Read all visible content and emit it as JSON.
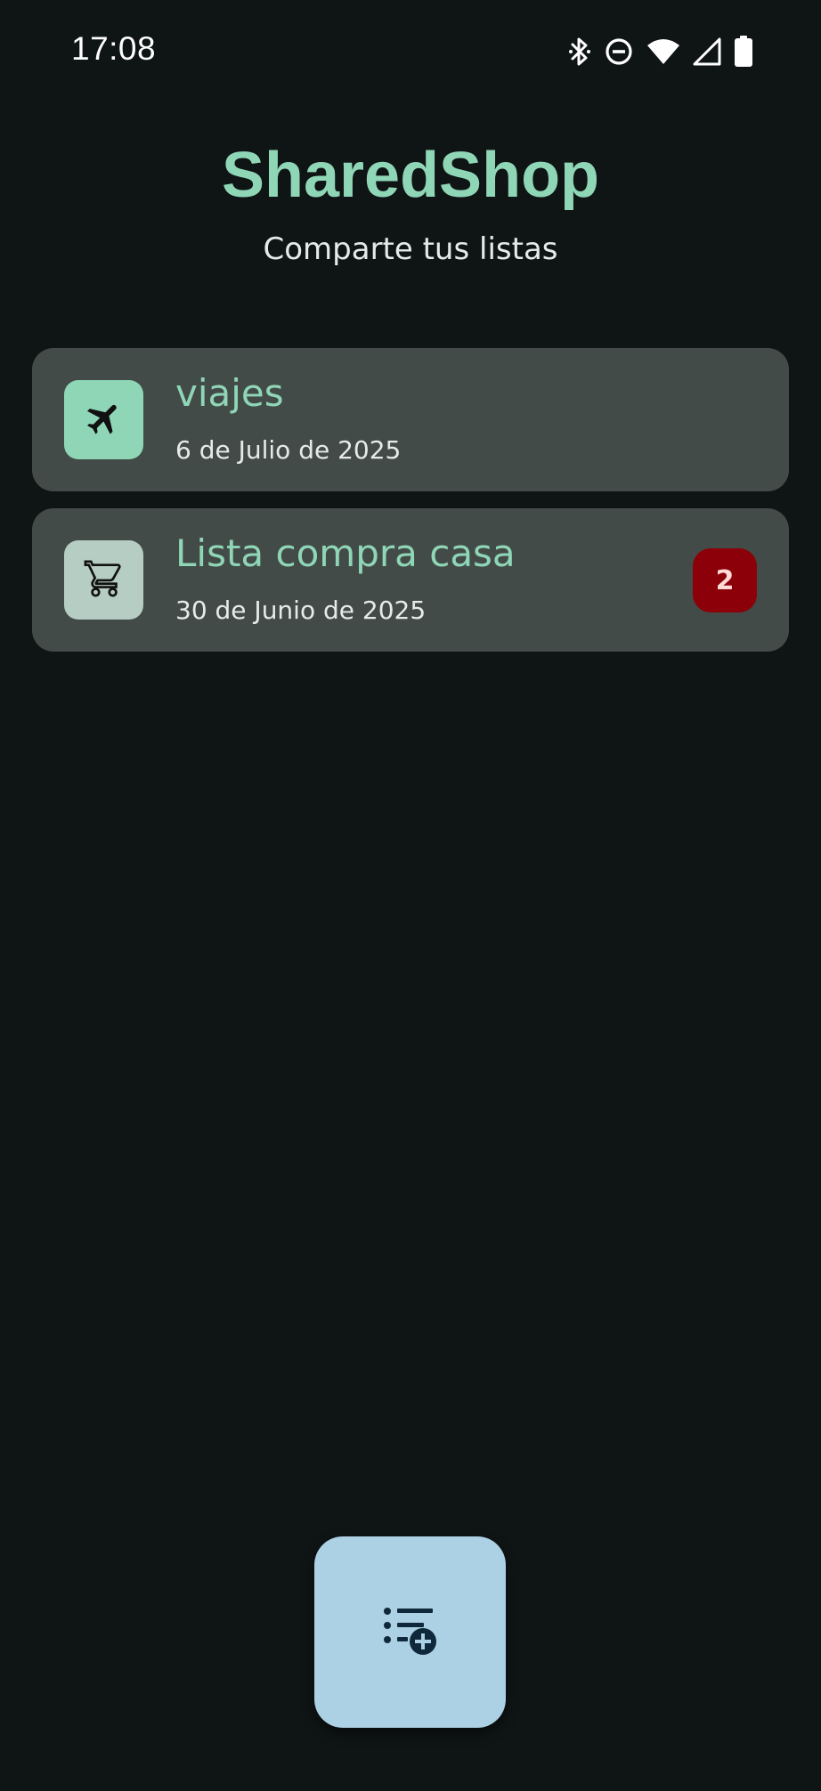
{
  "status_bar": {
    "time": "17:08",
    "icons": [
      "bluetooth-icon",
      "do-not-disturb-icon",
      "wifi-icon",
      "signal-icon",
      "battery-icon"
    ]
  },
  "header": {
    "title": "SharedShop",
    "subtitle": "Comparte tus listas"
  },
  "lists": [
    {
      "name": "viajes",
      "date": "6 de Julio de 2025",
      "icon": "airplane-icon",
      "icon_bg": "#8fd6b7"
    },
    {
      "name": "Lista compra casa",
      "date": "30 de Junio de 2025",
      "icon": "shopping-cart-icon",
      "icon_bg": "#b5cdc3",
      "badge": "2"
    }
  ],
  "fab": {
    "icon": "add-list-icon"
  },
  "colors": {
    "background": "#0f1414",
    "card": "#434b48",
    "accent": "#8fd6b7",
    "badge": "#8c0009",
    "fab": "#acd0e4"
  }
}
